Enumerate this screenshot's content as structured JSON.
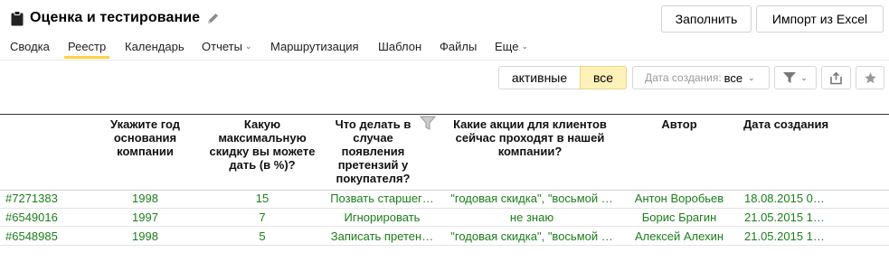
{
  "header": {
    "title": "Оценка и тестирование",
    "fill_button": "Заполнить",
    "import_button": "Импорт из Excel"
  },
  "tabs": [
    {
      "label": "Сводка"
    },
    {
      "label": "Реестр",
      "active": true
    },
    {
      "label": "Календарь"
    },
    {
      "label": "Отчеты",
      "has_caret": true
    },
    {
      "label": "Маршрутизация"
    },
    {
      "label": "Шаблон"
    },
    {
      "label": "Файлы"
    },
    {
      "label": "Еще",
      "has_caret": true
    }
  ],
  "filters": {
    "active_label": "активные",
    "all_label": "все",
    "selected": "все",
    "date_label": "Дата создания:",
    "date_value": "все"
  },
  "colors": {
    "accent_yellow": "#ffd23f",
    "selected_segment": "#fff2b8",
    "row_text_green": "#1a7f1a"
  },
  "table": {
    "columns": [
      "",
      "Укажите год основания компании",
      "Какую максимальную скидку вы можете дать (в %)?",
      "Что делать в случае появления претензий у покупателя?",
      "Какие акции для клиентов сейчас проходят в нашей компании?",
      "Автор",
      "Дата создания"
    ],
    "rows": [
      [
        "#7271383",
        "1998",
        "15",
        "Позвать старшег…",
        "\"годовая скидка\", \"восьмой …",
        "Антон Воробьев",
        "18.08.2015 0…"
      ],
      [
        "#6549016",
        "1997",
        "7",
        "Игнорировать",
        "не знаю",
        "Борис Брагин",
        "21.05.2015 1…"
      ],
      [
        "#6548985",
        "1998",
        "5",
        "Записать претен…",
        "\"годовая скидка\", \"восьмой …",
        "Алексей Алехин",
        "21.05.2015 1…"
      ]
    ]
  }
}
